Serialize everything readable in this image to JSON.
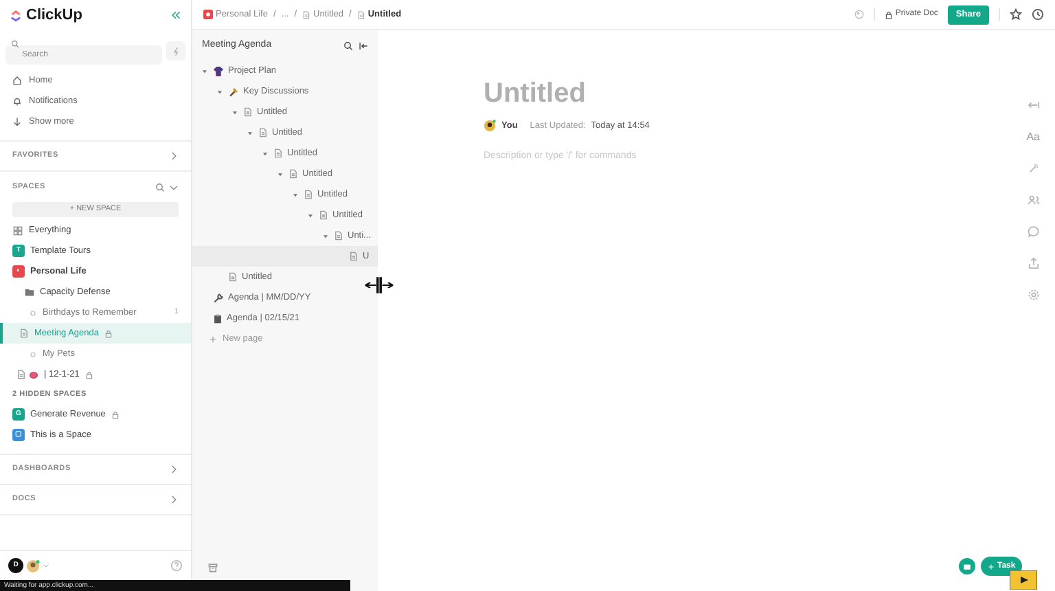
{
  "sidebar": {
    "logo": "ClickUp",
    "search": {
      "placeholder": "Search"
    },
    "nav": [
      {
        "kind": "home",
        "label": "Home"
      },
      {
        "kind": "bell",
        "label": "Notifications"
      },
      {
        "kind": "down",
        "label": "Show more"
      }
    ],
    "favorites": "FAVORITES",
    "spaces_header": "SPACES",
    "new_space": "+ NEW SPACE",
    "spaces": [
      {
        "kind": "everything",
        "label": "Everything",
        "selected": false
      },
      {
        "kind": "space",
        "label": "Template Tours",
        "avatar": "T",
        "color": "#1aa58f",
        "expanded": false,
        "selected": false
      },
      {
        "kind": "space",
        "label": "Personal Life",
        "avatar": "◐",
        "color": "#e5484d",
        "expanded": true,
        "selected": false
      },
      {
        "kind": "folder",
        "label": "Capacity Defense",
        "selected": false
      },
      {
        "kind": "list",
        "label": "Birthdays to Remember",
        "count": "1",
        "selected": false
      },
      {
        "kind": "doc",
        "label": "Meeting Agenda",
        "locked": true,
        "selected": true
      },
      {
        "kind": "list",
        "label": "My Pets",
        "selected": false
      },
      {
        "kind": "doc-emoji",
        "label": "| 12-1-21",
        "locked": true,
        "selected": false
      }
    ],
    "hidden_header": "2 HIDDEN SPACES",
    "hidden_spaces": [
      {
        "kind": "space",
        "label": "Generate Revenue",
        "avatar": "G",
        "color": "#1aa58f",
        "locked": true,
        "expanded": false,
        "selected": false
      },
      {
        "kind": "space",
        "label": "This is a Space",
        "avatar": "▢",
        "color": "#3b8fd6",
        "expanded": false,
        "selected": false
      }
    ],
    "sections": [
      "DASHBOARDS",
      "DOCS"
    ],
    "user_initial": "D"
  },
  "breadcrumb": [
    {
      "kind": "space",
      "label": "Personal Life",
      "selected": false
    },
    {
      "kind": "ellipsis",
      "separator": "/",
      "label": "...",
      "selected": false
    },
    {
      "kind": "doc",
      "separator": "/",
      "label": "Untitled",
      "selected": false
    },
    {
      "kind": "doc",
      "separator": "/",
      "label": "Untitled",
      "selected": true
    }
  ],
  "top_actions": {
    "privacy": "Private Doc",
    "share": "Share"
  },
  "tree": {
    "title": "Meeting Agenda",
    "items": [
      {
        "kind": "shirt",
        "label": "Project Plan",
        "expanded": true,
        "selected": false,
        "children": [
          {
            "kind": "tool",
            "label": "Key Discussions",
            "expanded": true,
            "selected": false,
            "children": [
              {
                "kind": "doc",
                "label": "Untitled",
                "expanded": true,
                "selected": false,
                "children": [
                  {
                    "kind": "doc",
                    "label": "Untitled",
                    "expanded": true,
                    "selected": false,
                    "children": [
                      {
                        "kind": "doc",
                        "label": "Untitled",
                        "expanded": true,
                        "selected": false,
                        "children": [
                          {
                            "kind": "doc",
                            "label": "Untitled",
                            "expanded": true,
                            "selected": false,
                            "children": [
                              {
                                "kind": "doc",
                                "label": "Untitled",
                                "expanded": true,
                                "selected": false,
                                "children": [
                                  {
                                    "kind": "doc",
                                    "label": "Untitled",
                                    "expanded": true,
                                    "selected": false,
                                    "children": [
                                      {
                                        "kind": "doc",
                                        "label": "Unti...",
                                        "expanded": true,
                                        "selected": false,
                                        "children": [
                                          {
                                            "kind": "doc",
                                            "label": "U",
                                            "selected": true
                                          }
                                        ]
                                      }
                                    ]
                                  }
                                ]
                              }
                            ]
                          }
                        ]
                      }
                    ]
                  }
                ]
              }
            ]
          },
          {
            "kind": "doc",
            "label": "Untitled",
            "selected": false
          }
        ]
      },
      {
        "kind": "wrench",
        "label": "Agenda | MM/DD/YY",
        "selected": false
      },
      {
        "kind": "clipboard",
        "label": "Agenda | 02/15/21",
        "selected": false
      }
    ],
    "new_page": "New page"
  },
  "doc": {
    "title": "Untitled",
    "author": "You",
    "updated_label": "Last Updated:",
    "updated": "Today at 14:54",
    "placeholder": "Description or type '/' for commands"
  },
  "rail": [
    {
      "kind": "arrow"
    },
    {
      "kind": "text",
      "label": "Aa"
    },
    {
      "kind": "wand"
    },
    {
      "kind": "people"
    },
    {
      "kind": "comment"
    },
    {
      "kind": "share"
    },
    {
      "kind": "gear"
    }
  ],
  "fab": {
    "task": "Task"
  },
  "status_bar": "Waiting for app.clickup.com..."
}
